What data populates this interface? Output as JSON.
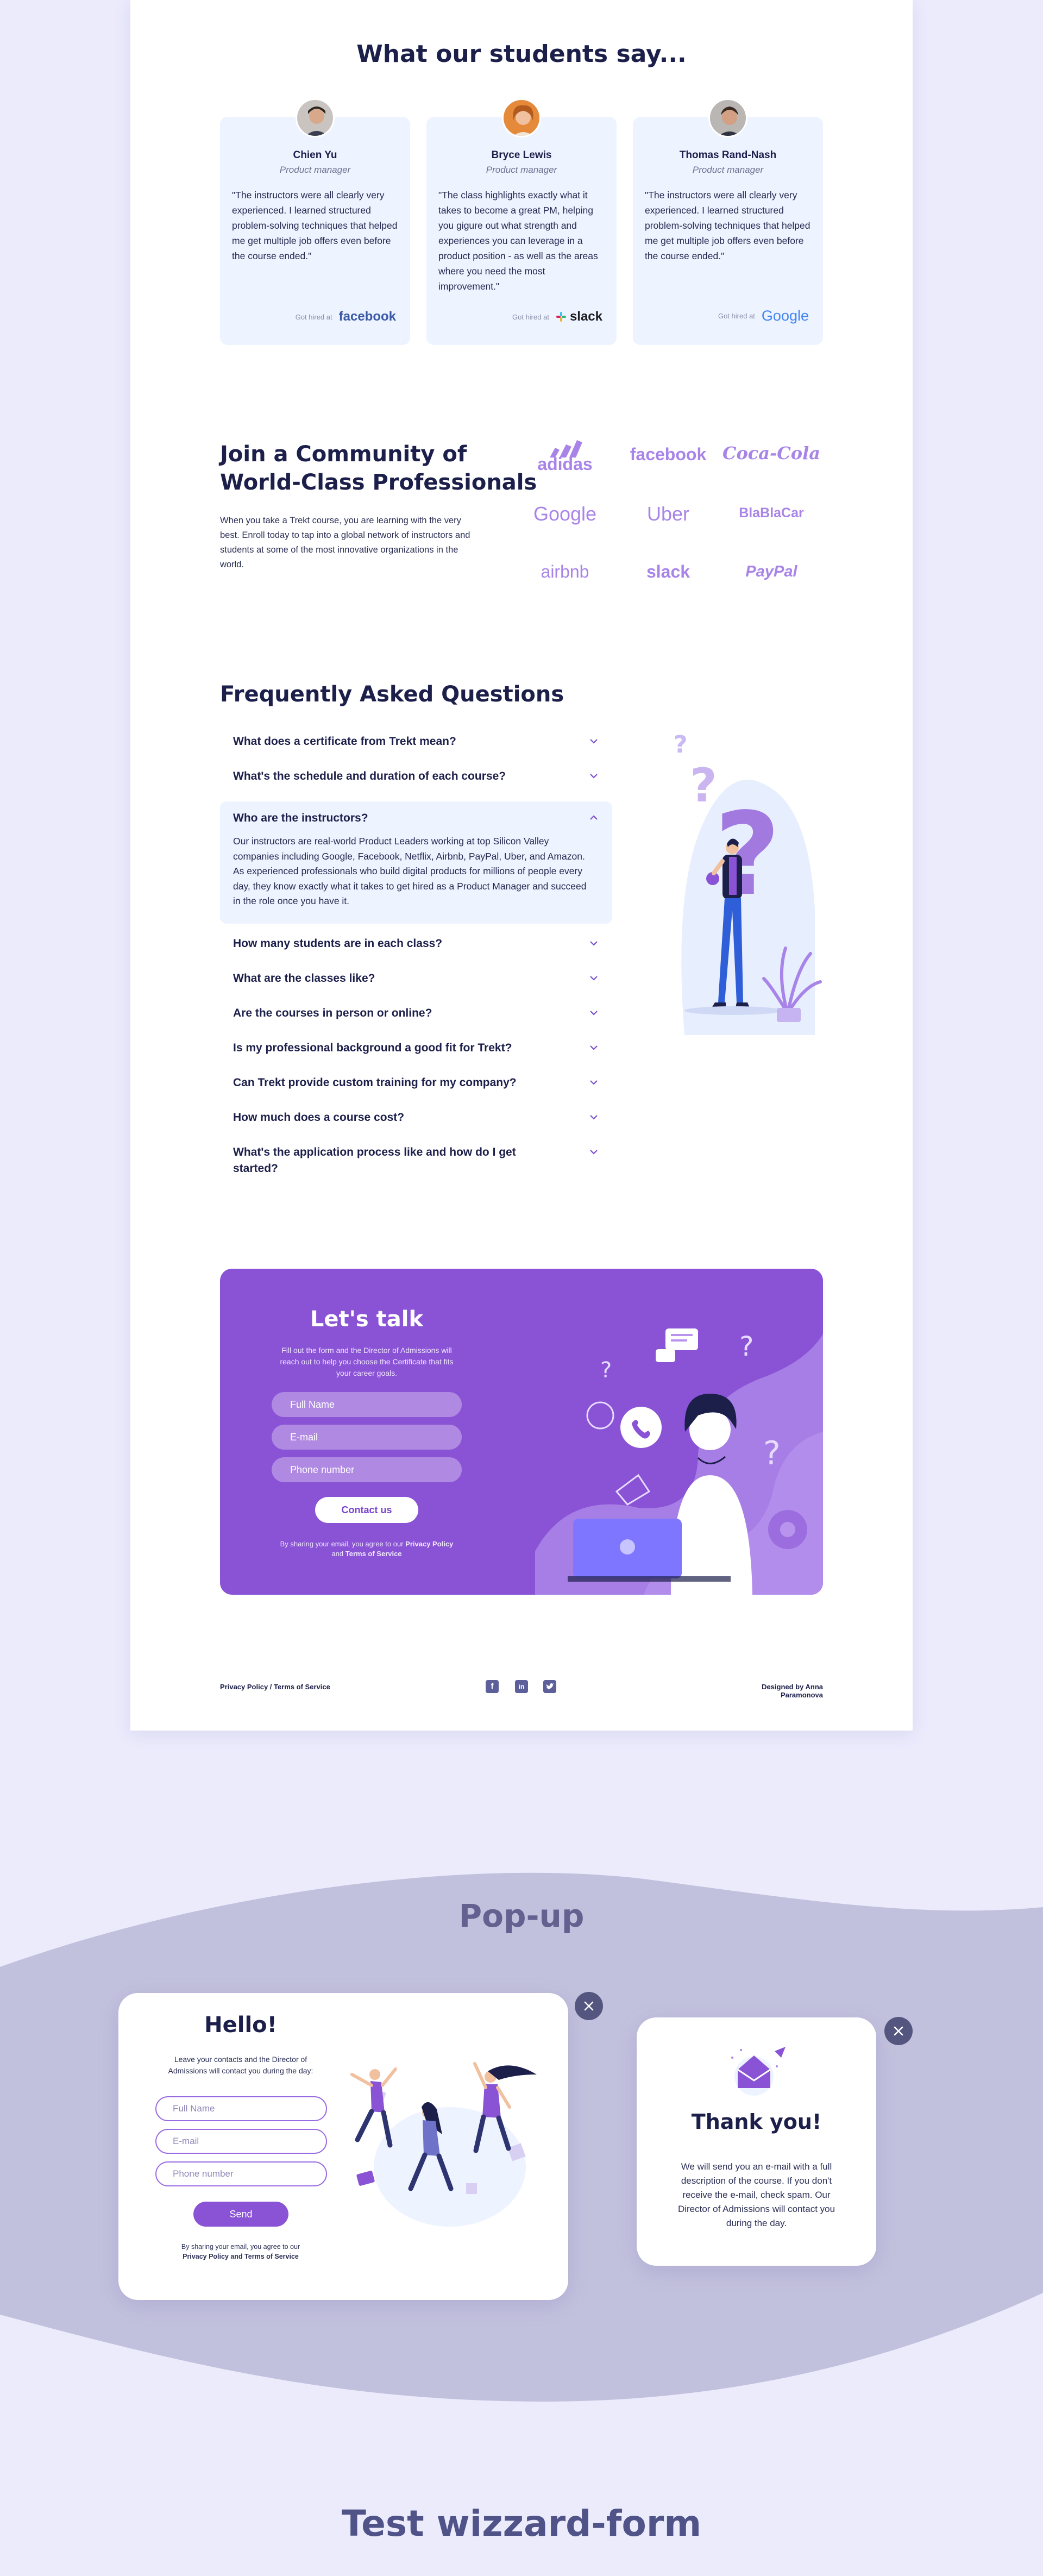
{
  "testimonials": {
    "title": "What our students say...",
    "items": [
      {
        "name": "Chien Yu",
        "role": "Product manager",
        "quote": "\"The instructors were all clearly very experienced. I learned structured problem-solving techniques that helped me get multiple job offers even before the course ended.\"",
        "hired_label": "Got hired at",
        "company": "facebook"
      },
      {
        "name": "Bryce Lewis",
        "role": "Product manager",
        "quote": "\"The class highlights exactly what it takes to become a great PM, helping you gigure out what strength and experiences you can leverage in a product position - as well as the areas where you need the most improvement.\"",
        "hired_label": "Got hired at",
        "company": "slack"
      },
      {
        "name": "Thomas Rand-Nash",
        "role": "Product manager",
        "quote": "\"The instructors were all clearly very experienced. I learned structured problem-solving techniques that helped me get multiple job offers even before the course ended.\"",
        "hired_label": "Got hired at",
        "company": "Google"
      }
    ]
  },
  "community": {
    "title_line1": "Join a Community of",
    "title_line2": "World-Class Professionals",
    "text": "When you take a Trekt course, you are learning with the very best. Enroll today to tap into a global network of instructors and students at some of the most innovative organizations in the world.",
    "brands": [
      "adidas",
      "facebook",
      "Coca-Cola",
      "Google",
      "Uber",
      "BlaBlaCar",
      "airbnb",
      "slack",
      "PayPal"
    ]
  },
  "faq": {
    "title": "Frequently Asked Questions",
    "questions": [
      "What does a certificate from Trekt mean?",
      "What's the schedule and duration of each course?",
      "Who are the instructors?",
      "How many students are in each class?",
      "What are the classes like?",
      "Are the courses in person or online?",
      "Is my professional background a good fit for Trekt?",
      "Can Trekt provide custom training for my company?",
      "How much does a course cost?",
      "What's the application process like and how do I get started?"
    ],
    "open_answer": "Our instructors are real-world Product Leaders working at top Silicon Valley companies including Google, Facebook, Netflix, Airbnb, PayPal, Uber, and Amazon. As experienced professionals who build digital products for millions of people every day, they know exactly what it takes to get hired as a Product Manager and succeed in the role once you have it."
  },
  "contact": {
    "title": "Let's talk",
    "subtitle": "Fill out the form and the Director of Admissions will reach out to help you choose the Certificate that fits your career goals.",
    "fields": [
      "Full Name",
      "E-mail",
      "Phone number"
    ],
    "button": "Contact us",
    "note_prefix": "By sharing your email, you agree to our",
    "privacy": "Privacy Policy",
    "and": "and",
    "terms": "Terms of Service"
  },
  "footer": {
    "links": "Privacy Policy   /   Terms of Service",
    "designed_by": "Designed by Anna Paramonova"
  },
  "popup": {
    "section_title": "Pop-up",
    "hello_title": "Hello!",
    "hello_text": "Leave your contacts and the Director of Admissions will contact you during the day:",
    "fields": [
      "Full Name",
      "E-mail",
      "Phone number"
    ],
    "send": "Send",
    "note_line1": "By sharing your email, you agree to our",
    "note_line2": "Privacy Policy and Terms of Service",
    "thanks_title": "Thank you!",
    "thanks_text": "We will send you an e-mail with a full description of the course. If you don't receive the e-mail, check spam. Our Director of Admissions will contact you during the day."
  },
  "wizard": {
    "title": "Test wizzard-form"
  },
  "colors": {
    "accent": "#8a52d5",
    "navy": "#1c1f4a",
    "bg": "#ebebfc",
    "card": "#edf3ff",
    "wave": "#c2c1dd"
  }
}
